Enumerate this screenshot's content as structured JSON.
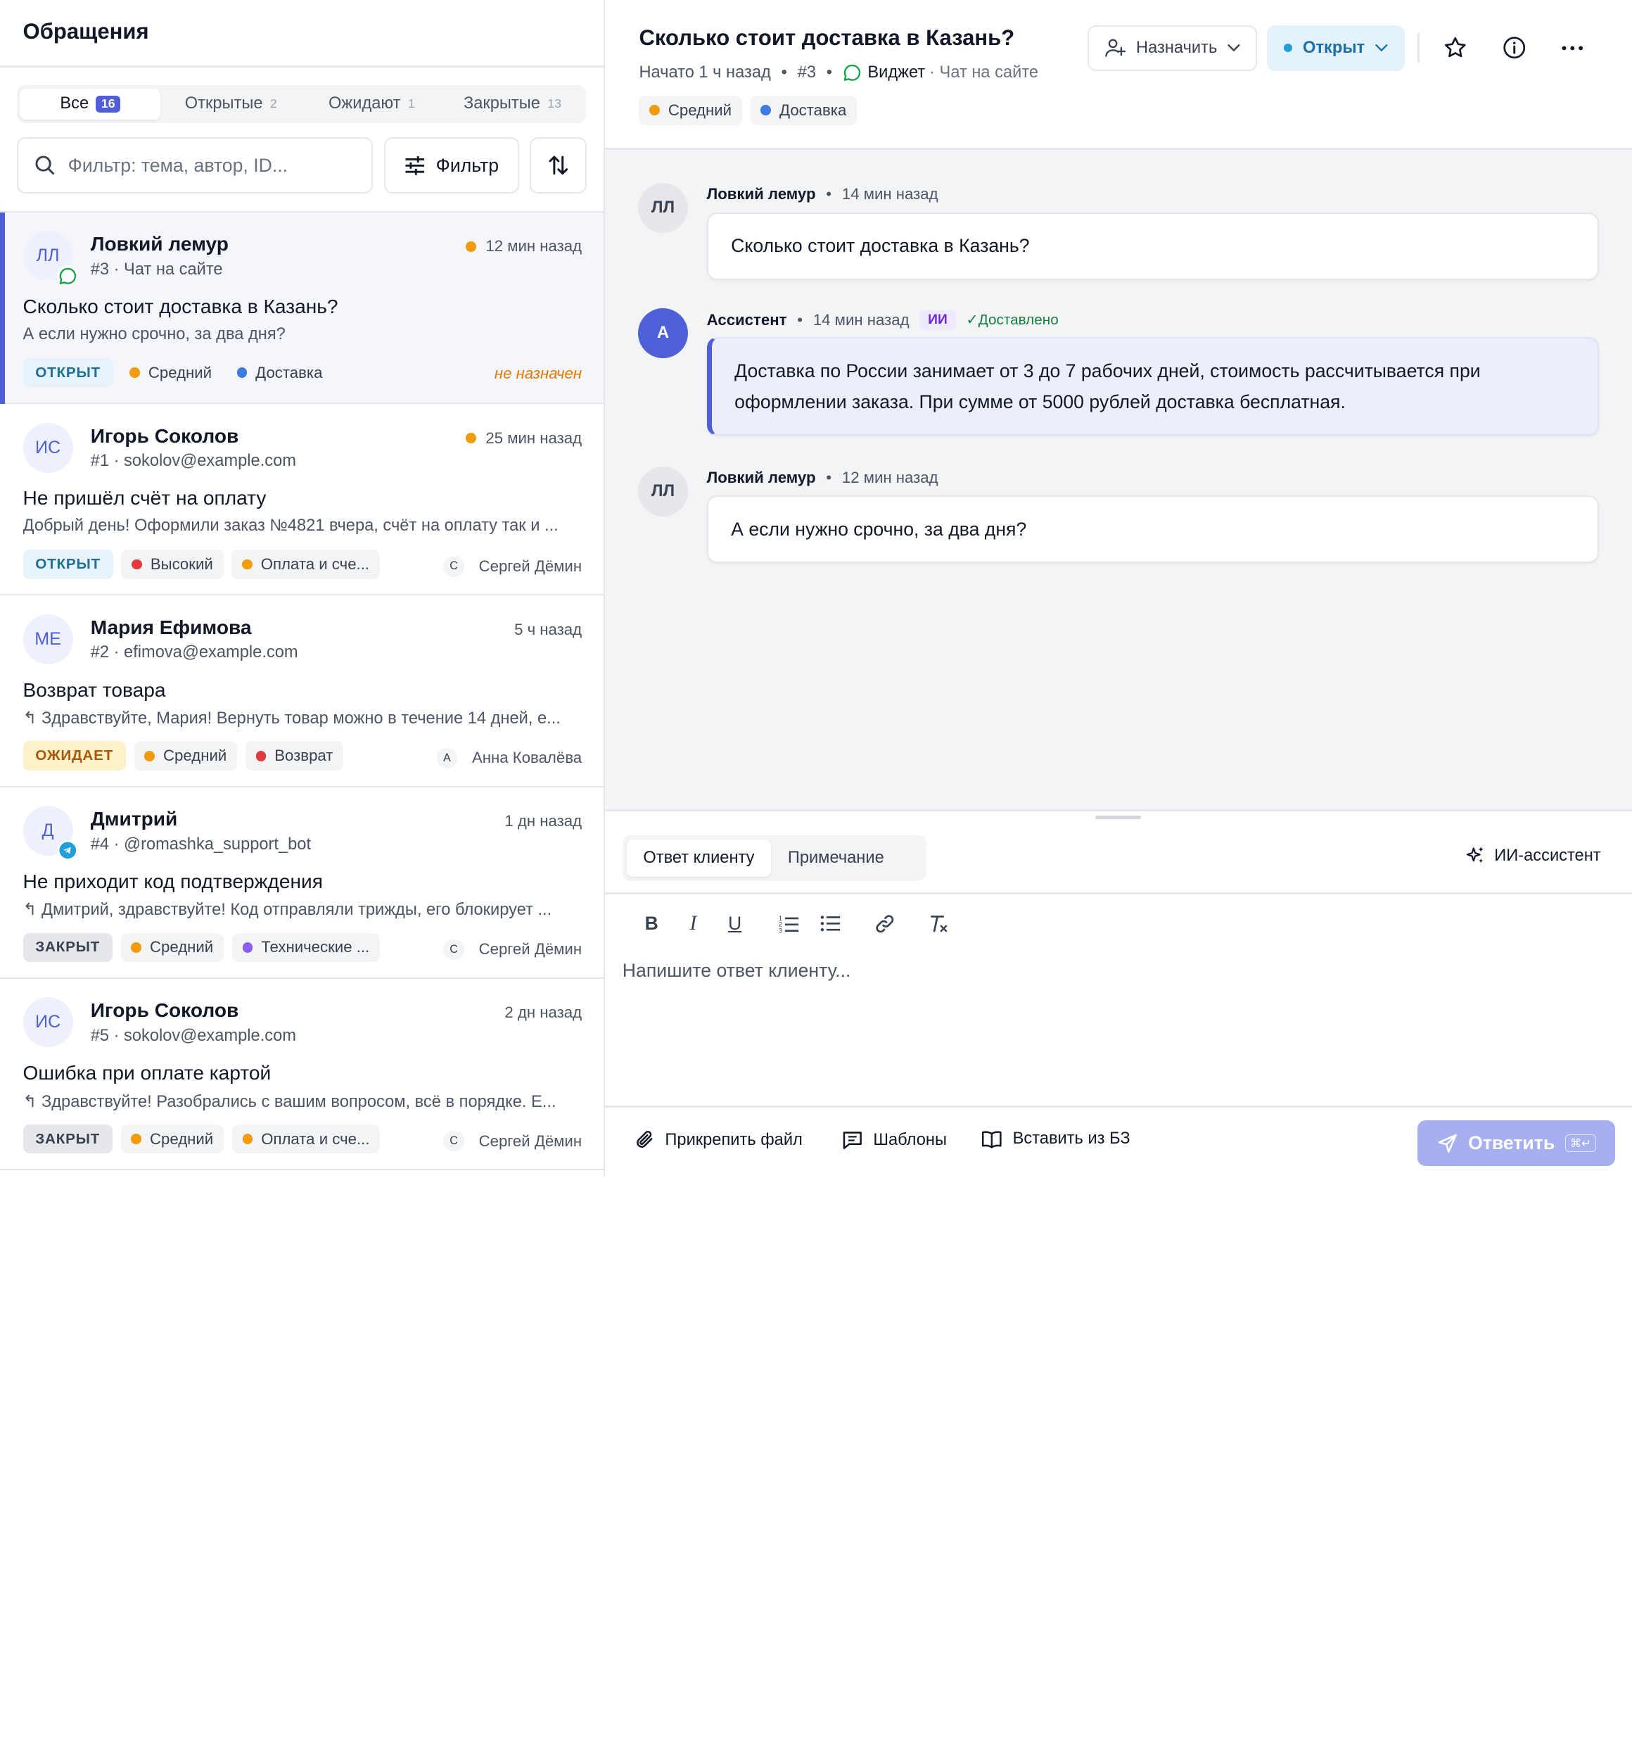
{
  "sidebar": {
    "title": "Обращения",
    "tabs": [
      {
        "label": "Все",
        "count": "16"
      },
      {
        "label": "Открытые",
        "count": "2"
      },
      {
        "label": "Ожидают",
        "count": "1"
      },
      {
        "label": "Закрытые",
        "count": "13"
      }
    ],
    "search_placeholder": "Фильтр: тема, автор, ID...",
    "filter_label": "Фильтр"
  },
  "conversations": [
    {
      "initials": "ЛЛ",
      "name": "Ловкий лемур",
      "meta": "#3 · Чат на сайте",
      "time": "12 мин назад",
      "subject": "Сколько стоит доставка в Казань?",
      "preview": "А если нужно срочно, за два дня?",
      "status": "ОТКРЫТ",
      "priority": "Средний",
      "category": "Доставка",
      "assignee": "не назначен"
    },
    {
      "initials": "ИС",
      "name": "Игорь Соколов",
      "meta": "#1 · sokolov@example.com",
      "time": "25 мин назад",
      "subject": "Не пришёл счёт на оплату",
      "preview": "Добрый день! Оформили заказ №4821 вчера, счёт на оплату так и ...",
      "status": "ОТКРЫТ",
      "priority": "Высокий",
      "category": "Оплата и сче...",
      "assignee_initial": "С",
      "assignee": "Сергей Дёмин"
    },
    {
      "initials": "МЕ",
      "name": "Мария Ефимова",
      "meta": "#2 · efimova@example.com",
      "time": "5 ч назад",
      "subject": "Возврат товара",
      "preview": "Здравствуйте, Мария! Вернуть товар можно в течение 14 дней, е...",
      "status": "ОЖИДАЕТ",
      "priority": "Средний",
      "category": "Возврат",
      "assignee_initial": "А",
      "assignee": "Анна Ковалёва"
    },
    {
      "initials": "Д",
      "name": "Дмитрий",
      "meta": "#4 · @romashka_support_bot",
      "time": "1 дн назад",
      "subject": "Не приходит код подтверждения",
      "preview": "Дмитрий, здравствуйте! Код отправляли трижды, его блокирует ...",
      "status": "ЗАКРЫТ",
      "priority": "Средний",
      "category": "Технические ...",
      "assignee_initial": "С",
      "assignee": "Сергей Дёмин"
    },
    {
      "initials": "ИС",
      "name": "Игорь Соколов",
      "meta": "#5 · sokolov@example.com",
      "time": "2 дн назад",
      "subject": "Ошибка при оплате картой",
      "preview": "Здравствуйте! Разобрались с вашим вопросом, всё в порядке. Е...",
      "status": "ЗАКРЫТ",
      "priority": "Средний",
      "category": "Оплата и сче...",
      "assignee_initial": "С",
      "assignee": "Сергей Дёмин"
    }
  ],
  "ticket": {
    "title": "Сколько стоит доставка в Казань?",
    "started": "Начато 1 ч назад",
    "id": "#3",
    "channel": "Виджет",
    "channel_sub": "· Чат на сайте",
    "priority": "Средний",
    "category": "Доставка",
    "assign_label": "Назначить",
    "status_label": "Открыт"
  },
  "messages": [
    {
      "initials": "ЛЛ",
      "author": "Ловкий лемур",
      "time": "14 мин назад",
      "text": "Сколько стоит доставка в Казань?"
    },
    {
      "initials": "А",
      "author": "Ассистент",
      "time": "14 мин назад",
      "ai_chip": "ИИ",
      "delivered": "✓Доставлено",
      "text": "Доставка по России занимает от 3 до 7 рабочих дней, стоимость рассчитывается при оформлении заказа. При сумме от 5000 рублей доставка бесплатная."
    },
    {
      "initials": "ЛЛ",
      "author": "Ловкий лемур",
      "time": "12 мин назад",
      "text": "А если нужно срочно, за два дня?"
    }
  ],
  "composer": {
    "tab_reply": "Ответ клиенту",
    "tab_note": "Примечание",
    "ai_assistant": "ИИ-ассистент",
    "placeholder": "Напишите ответ клиенту...",
    "attach": "Прикрепить файл",
    "templates": "Шаблоны",
    "kb": "Вставить из БЗ",
    "send": "Ответить",
    "send_kbd": "⌘↵"
  },
  "colors": {
    "accent": "#4f5fd7",
    "medium": "#f29b0c",
    "high": "#e03a3a",
    "blue_tag": "#3b7de0",
    "purple_tag": "#8b5cf6",
    "unassigned": "#e07b00"
  }
}
